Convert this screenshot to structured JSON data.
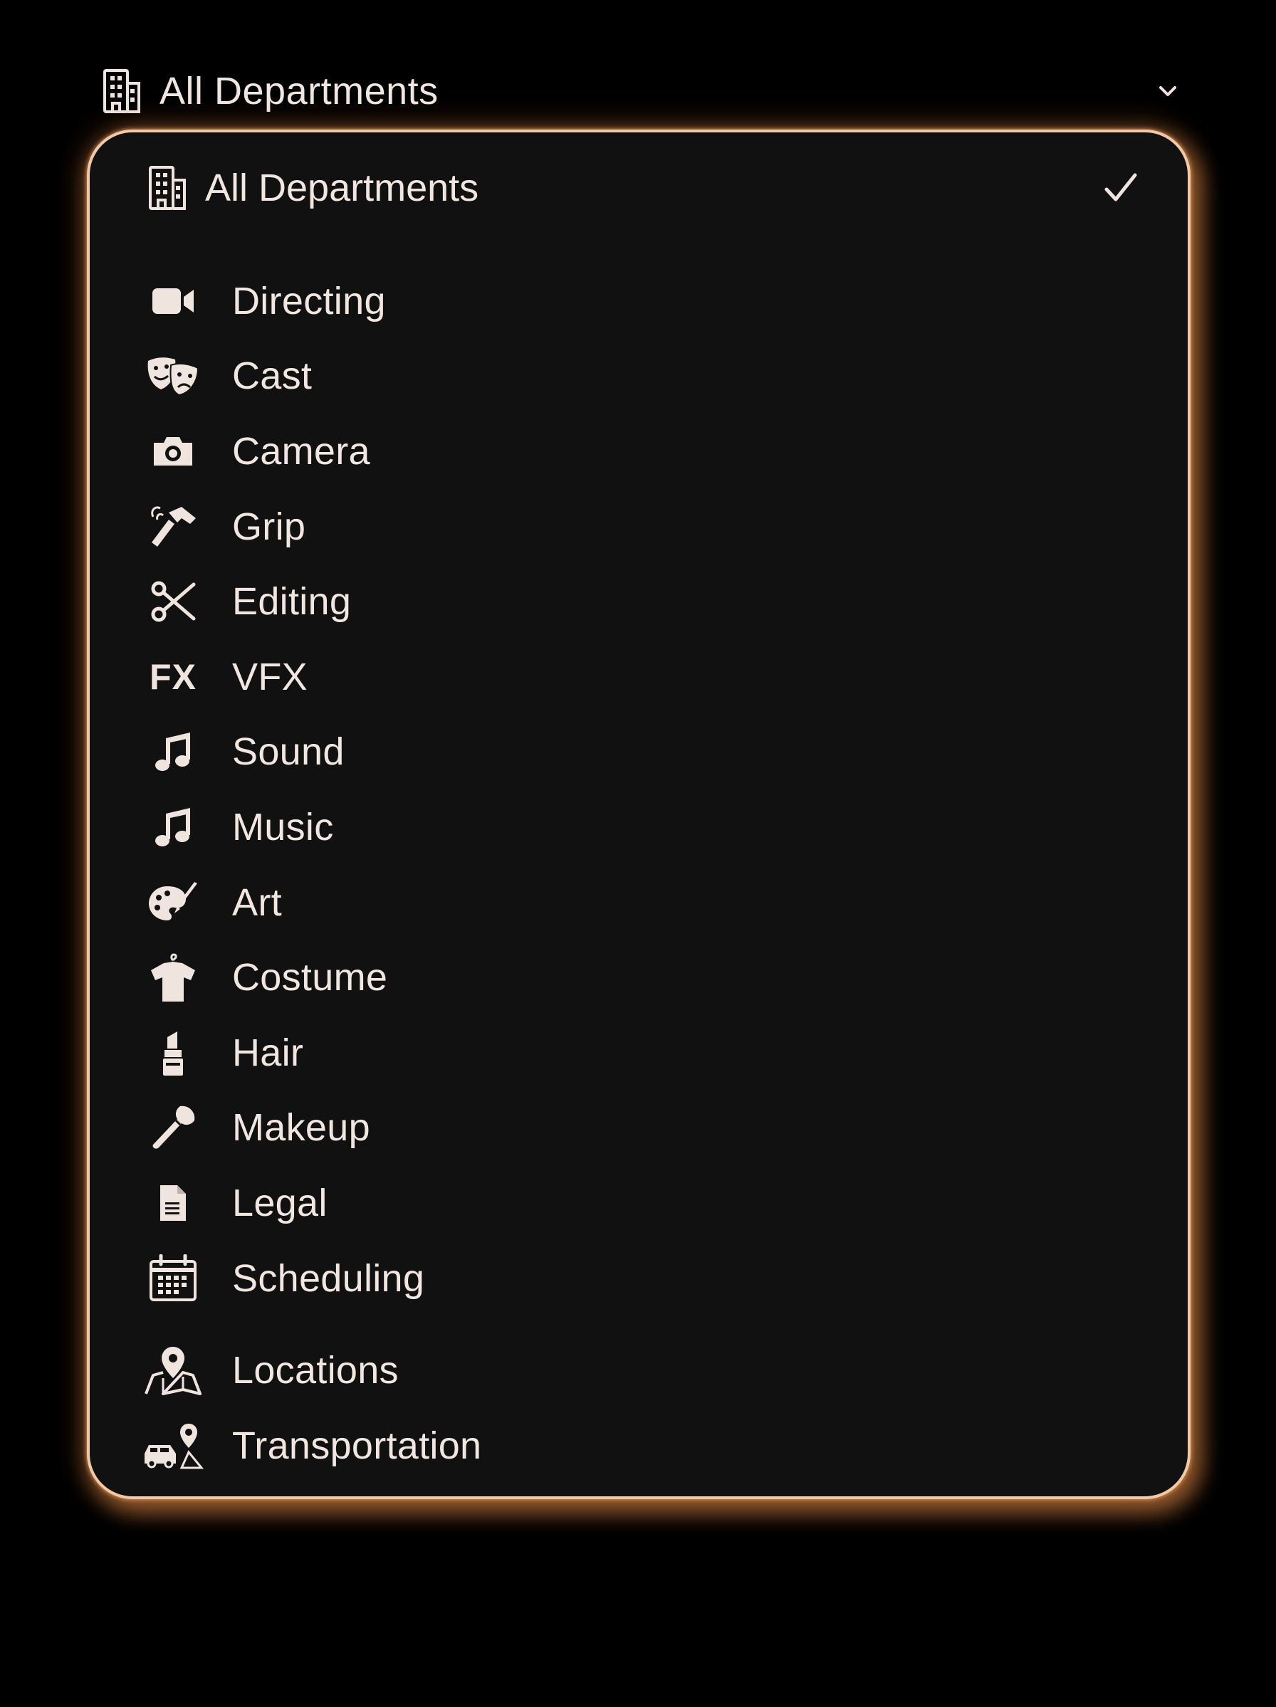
{
  "select": {
    "selected_label": "All Departments",
    "icon": "building-icon"
  },
  "dropdown": {
    "selected_option": {
      "label": "All Departments",
      "icon": "building-icon",
      "checked": true
    },
    "options": [
      {
        "label": "Directing",
        "icon": "video-camera-icon"
      },
      {
        "label": "Cast",
        "icon": "theater-masks-icon"
      },
      {
        "label": "Camera",
        "icon": "camera-icon"
      },
      {
        "label": "Grip",
        "icon": "hammer-icon"
      },
      {
        "label": "Editing",
        "icon": "scissors-icon"
      },
      {
        "label": "VFX",
        "icon": "fx-icon",
        "icon_text": "FX"
      },
      {
        "label": "Sound",
        "icon": "music-note-icon"
      },
      {
        "label": "Music",
        "icon": "music-note-icon"
      },
      {
        "label": "Art",
        "icon": "palette-brush-icon"
      },
      {
        "label": "Costume",
        "icon": "shirt-hanger-icon"
      },
      {
        "label": "Hair",
        "icon": "lipstick-icon"
      },
      {
        "label": "Makeup",
        "icon": "makeup-brush-icon"
      },
      {
        "label": "Legal",
        "icon": "document-icon"
      },
      {
        "label": "Scheduling",
        "icon": "calendar-icon"
      },
      {
        "label": "Locations",
        "icon": "map-pin-icon"
      },
      {
        "label": "Transportation",
        "icon": "car-pin-icon"
      }
    ]
  },
  "colors": {
    "background": "#000000",
    "panel": "#111111",
    "border": "#f2c9a6",
    "glow": "#e08c46",
    "text": "#f1e6e0"
  }
}
